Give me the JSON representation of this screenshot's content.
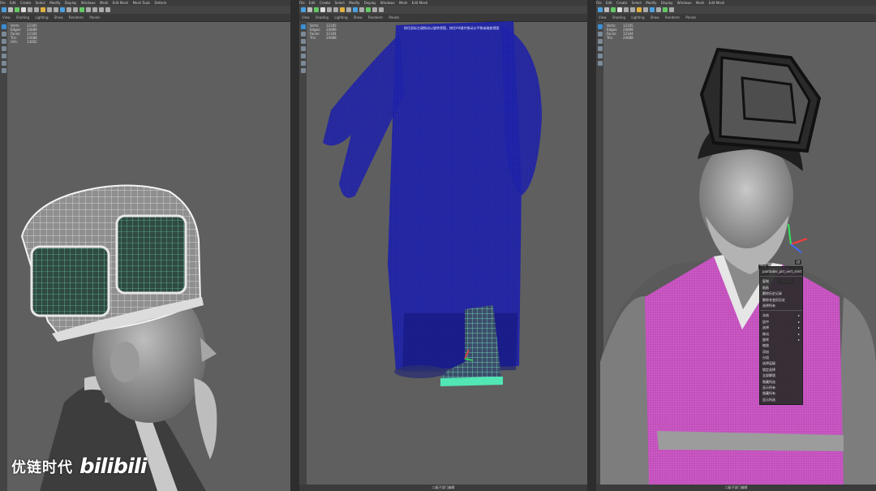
{
  "menubar": {
    "items": [
      "File",
      "Edit",
      "Create",
      "Select",
      "Modify",
      "Display",
      "Windows",
      "Mesh",
      "Edit Mesh",
      "Mesh Tools",
      "Deform",
      "UV",
      "Generate",
      "Cache",
      "Arnold",
      "Help"
    ]
  },
  "panelbar": {
    "items": [
      "View",
      "Shading",
      "Lighting",
      "Show",
      "Renderer",
      "Panels"
    ]
  },
  "hud": {
    "labels": [
      "Verts:",
      "Edges:",
      "Faces:",
      "Tris:",
      "UVs:"
    ],
    "values": [
      "12345",
      "24689",
      "12344",
      "24688",
      "13002"
    ]
  },
  "left_pane": {
    "status": ""
  },
  "middle_pane": {
    "notice": "按住鼠标左键拖动以旋转视图，按住Alt键并拖动以平移或缩放视图",
    "status": "二级子部门编辑"
  },
  "right_pane": {
    "status": "二级子部门编辑",
    "marking_menu": [
      "顶点",
      "边",
      "面",
      "对象模式"
    ],
    "context_menu": {
      "header": "paintable_pkt_vert_shirt",
      "items_top": [
        "复制",
        "粘贴",
        "删除历史记录",
        "删除非变形历史",
        "选择所有"
      ],
      "items_bottom": [
        "冻结",
        "居中",
        "选择",
        "移动",
        "旋转",
        "缩放",
        "添加",
        "分组",
        "选择层级",
        "锁定选择",
        "全部解锁",
        "隐藏所选",
        "显示所有",
        "隐藏所有",
        "显示所选"
      ],
      "submenu_arrow": "▸"
    }
  },
  "watermark": {
    "company": "优链时代",
    "logo": "bilibili"
  },
  "colors": {
    "viewport": "#5f5f5f",
    "cloth_blue": "#1c1f9e",
    "cloth_pink": "#d65ad2",
    "wire_green": "#51e6b4",
    "ui_dark": "#3c3c3c"
  }
}
